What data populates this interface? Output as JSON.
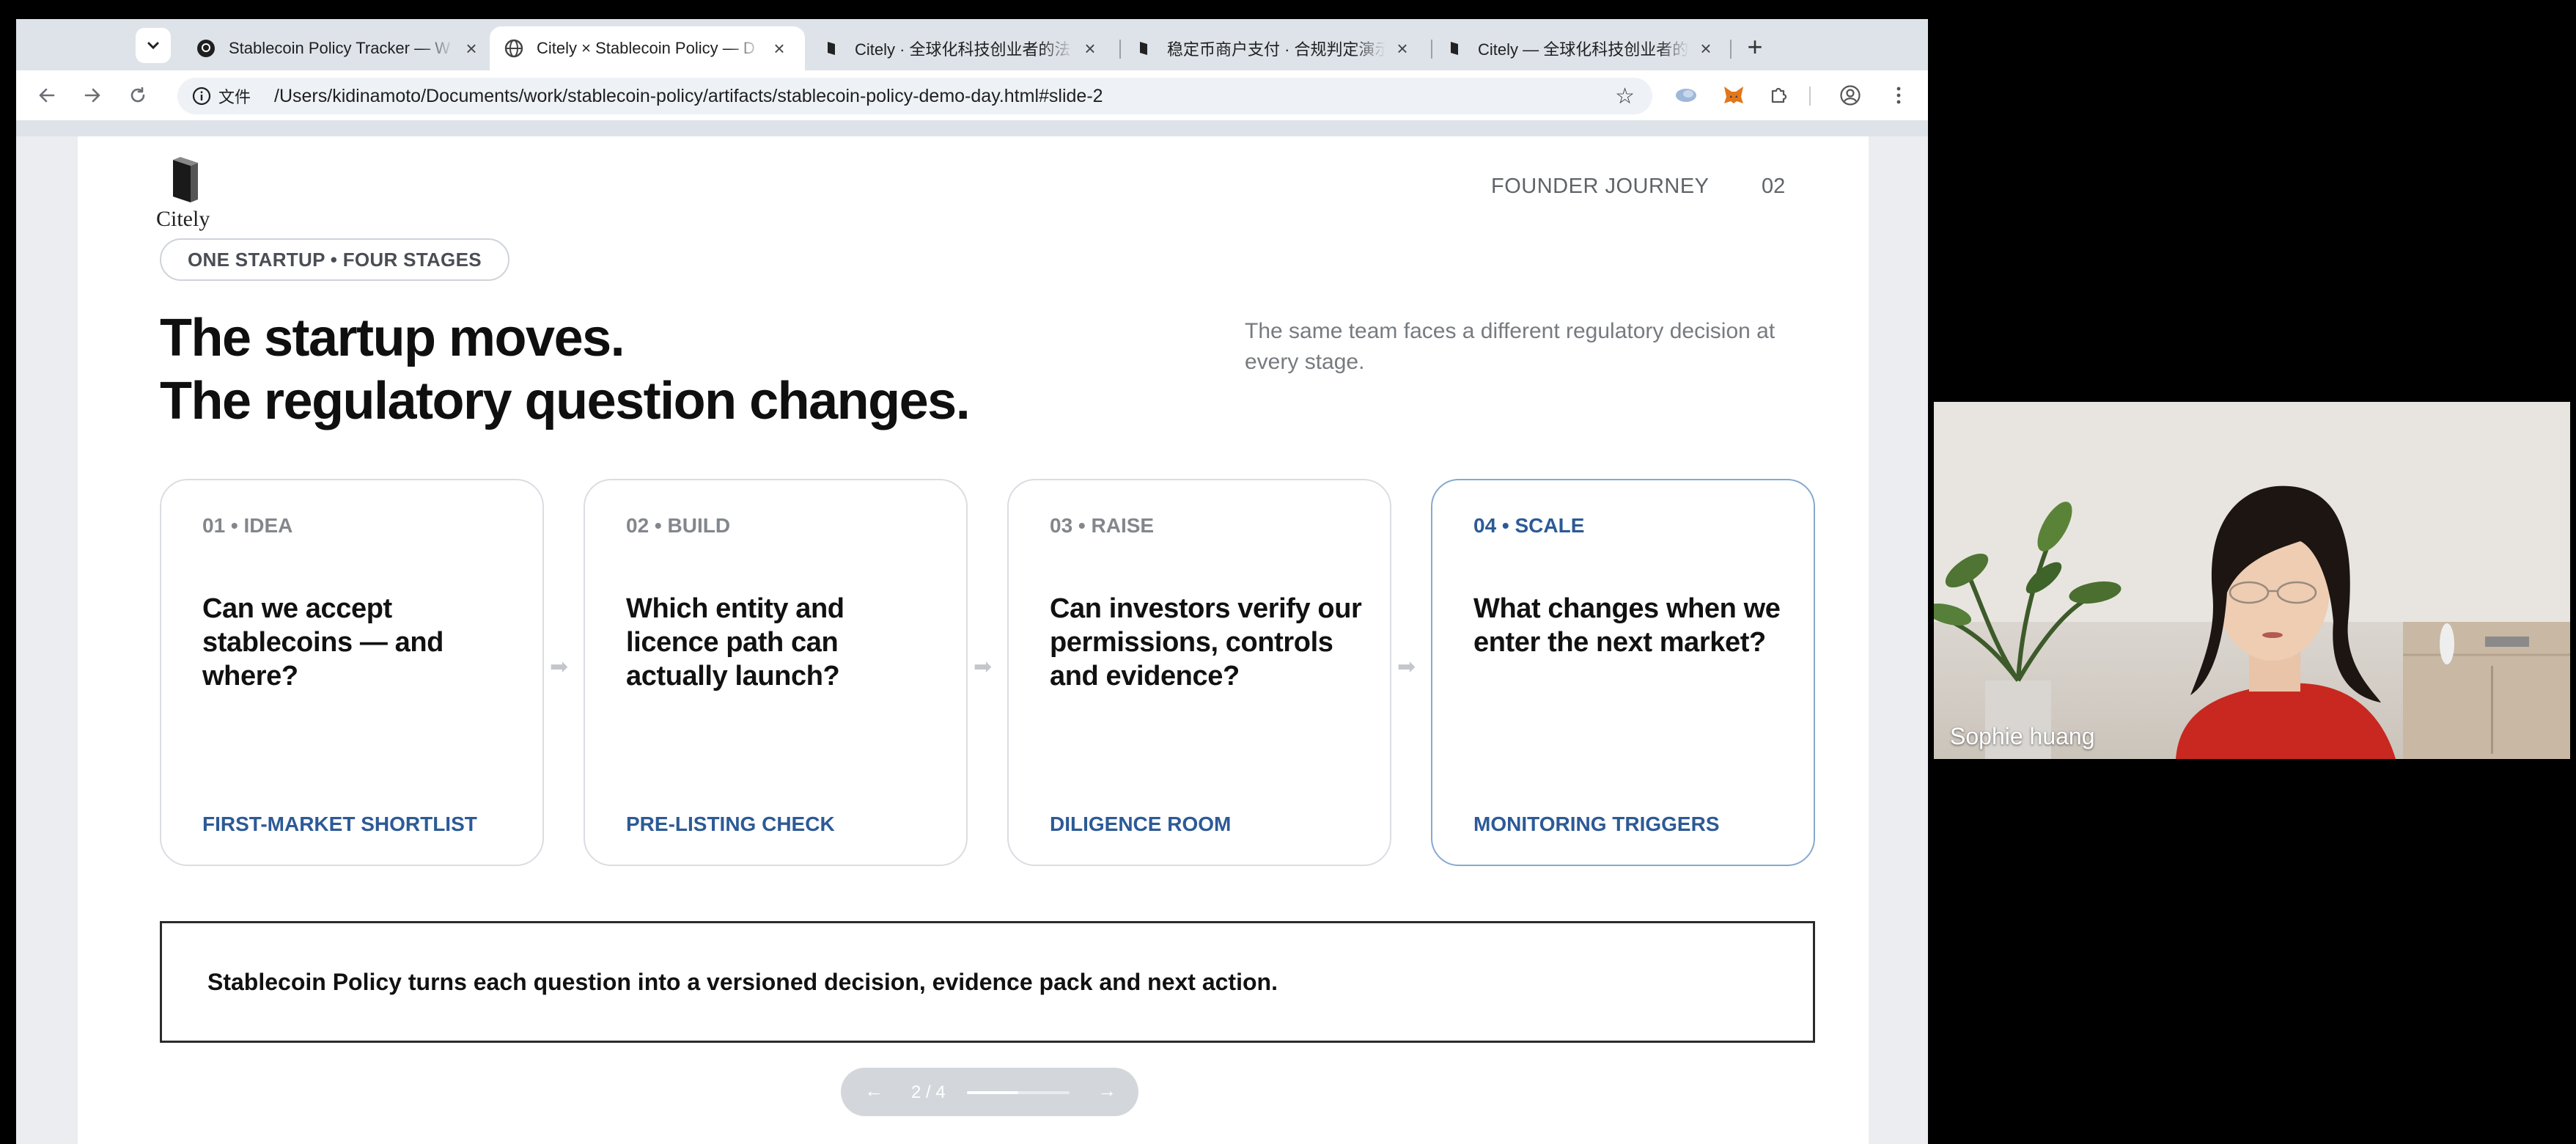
{
  "browser": {
    "tabs": [
      {
        "title": "Stablecoin Policy Tracker — W",
        "active": false
      },
      {
        "title": "Citely × Stablecoin Policy — D",
        "active": true
      },
      {
        "title": "Citely · 全球化科技创业者的法",
        "active": false
      },
      {
        "title": "稳定币商户支付 · 合规判定演示",
        "active": false
      },
      {
        "title": "Citely — 全球化科技创业者的法",
        "active": false
      }
    ],
    "address": {
      "info_label": "文件",
      "url": "/Users/kidinamoto/Documents/work/stablecoin-policy/artifacts/stablecoin-policy-demo-day.html#slide-2"
    }
  },
  "slide": {
    "logo_text": "Citely",
    "section": "FOUNDER JOURNEY",
    "page_number": "02",
    "pill": "ONE STARTUP • FOUR STAGES",
    "headline_line1": "The startup moves.",
    "headline_line2": "The regulatory question changes.",
    "subhead": "The same team faces a different regulatory decision at every stage.",
    "cards": [
      {
        "stage": "01 • IDEA",
        "question": "Can we accept stablecoins — and where?",
        "deliverable": "FIRST-MARKET SHORTLIST"
      },
      {
        "stage": "02 • BUILD",
        "question": "Which entity and licence path can actually launch?",
        "deliverable": "PRE-LISTING CHECK"
      },
      {
        "stage": "03 • RAISE",
        "question": "Can investors verify our permissions, controls and evidence?",
        "deliverable": "DILIGENCE ROOM"
      },
      {
        "stage": "04 • SCALE",
        "question": "What changes when we enter the next market?",
        "deliverable": "MONITORING TRIGGERS"
      }
    ],
    "callout": "Stablecoin Policy turns each question into a versioned decision, evidence pack and next action.",
    "pager": {
      "label": "2 / 4",
      "progress": 0.5
    }
  },
  "video": {
    "participant_name": "Sophie huang"
  },
  "colors": {
    "accent_blue": "#2c5a96",
    "accent_border": "#86a9cf"
  }
}
